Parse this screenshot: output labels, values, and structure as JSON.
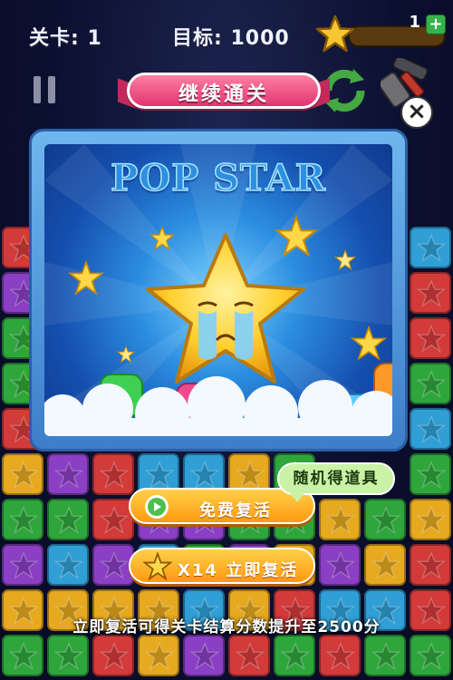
{
  "hud": {
    "level_label": "关卡: 1",
    "target_label": "目标: 1000",
    "star_count": "1",
    "plus_label": "+",
    "progress_fraction": 0.0
  },
  "popup": {
    "banner_title": "继续通关",
    "logo_text": "POP STAR",
    "close_label": "×"
  },
  "buttons": {
    "free_revive_label": "免费复活",
    "random_item_label": "随机得道具",
    "star_revive_label": "X14 立即复活"
  },
  "footer": {
    "hint_text": "立即复活可得关卡结算分数提升至2500分"
  },
  "colors": {
    "red": "#d33a3a",
    "green": "#2fa63c",
    "blue": "#2f9fd6",
    "purple": "#8a3fc4",
    "yellow": "#e6a91f"
  },
  "grid_rows": [
    [
      "red",
      "red",
      "",
      "",
      "",
      "",
      "",
      "",
      "",
      "blue"
    ],
    [
      "purple",
      "",
      "",
      "",
      "",
      "",
      "",
      "",
      "",
      "red"
    ],
    [
      "green",
      "",
      "",
      "",
      "",
      "",
      "",
      "",
      "",
      "red"
    ],
    [
      "green",
      "",
      "",
      "",
      "",
      "",
      "",
      "",
      "",
      "green"
    ],
    [
      "red",
      "",
      "",
      "",
      "",
      "",
      "",
      "",
      "",
      "blue"
    ],
    [
      "yellow",
      "purple",
      "red",
      "blue",
      "blue",
      "yellow",
      "green",
      "",
      "",
      "green"
    ],
    [
      "green",
      "green",
      "red",
      "purple",
      "purple",
      "green",
      "green",
      "yellow",
      "green",
      "yellow"
    ],
    [
      "purple",
      "blue",
      "purple",
      "blue",
      "green",
      "purple",
      "yellow",
      "purple",
      "yellow",
      "red"
    ],
    [
      "yellow",
      "yellow",
      "yellow",
      "yellow",
      "blue",
      "yellow",
      "red",
      "blue",
      "blue",
      "red"
    ],
    [
      "green",
      "green",
      "red",
      "yellow",
      "purple",
      "red",
      "green",
      "red",
      "green",
      "green"
    ]
  ]
}
